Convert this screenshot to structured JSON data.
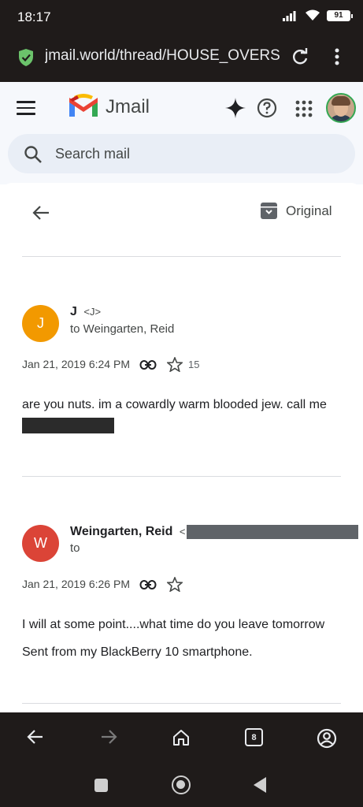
{
  "status_bar": {
    "time": "18:17",
    "battery": "91"
  },
  "browser": {
    "url": "jmail.world/thread/HOUSE_OVERS",
    "tab_count": "8"
  },
  "app": {
    "title": "Jmail",
    "search_placeholder": "Search mail"
  },
  "thread": {
    "original_label": "Original",
    "messages": [
      {
        "avatar_letter": "J",
        "avatar_color": "#f29900",
        "sender": "J",
        "sender_addr": "<J>",
        "recipient": "to Weingarten, Reid",
        "date": "Jan 21, 2019 6:24 PM",
        "star_count": "15",
        "body": "are you nuts. im a cowardly warm blooded jew. call me"
      },
      {
        "avatar_letter": "W",
        "avatar_color": "#db4437",
        "sender": "Weingarten, Reid",
        "sender_addr": "<",
        "recipient": "to",
        "date": "Jan 21, 2019 6:26 PM",
        "body": "I will at some point....what time do you leave tomorrow",
        "signature": "Sent from my BlackBerry 10 smartphone."
      }
    ]
  },
  "colors": {
    "app_bg": "#f6f8fc",
    "search_bg": "#e9eef6",
    "chrome_dark": "#1f1b1a"
  }
}
